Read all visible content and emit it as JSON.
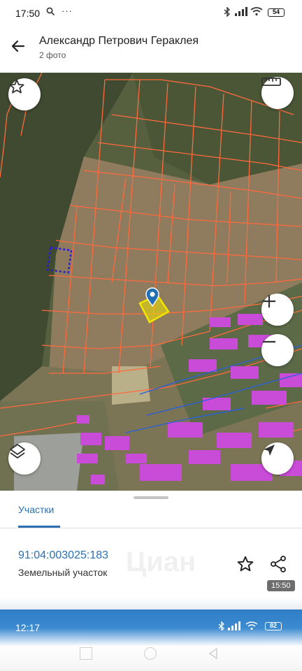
{
  "status_bar": {
    "time": "17:50",
    "icons": [
      "search-icon",
      "more-icon",
      "bluetooth-icon",
      "signal-icon",
      "wifi-icon"
    ],
    "battery": "54"
  },
  "header": {
    "title": "Александр Петрович Гераклея",
    "subtitle": "2 фото"
  },
  "map": {
    "controls": [
      "favorite-star",
      "ruler",
      "zoom-in",
      "zoom-out",
      "layers",
      "my-location"
    ],
    "colors": {
      "parcel_outline": "#ff6a3d",
      "selected_parcel": "#f2e600",
      "marker": "#1f6fb2",
      "building": "#c94cd8",
      "dotted_outline": "#2a1bd6"
    }
  },
  "tabs": {
    "active_label": "Участки"
  },
  "parcel": {
    "cadastral_number": "91:04:003025:183",
    "type": "Земельный участок",
    "watermark": "Циан",
    "video_time": "15:50"
  },
  "second_screen": {
    "time": "12:17",
    "battery": "82"
  }
}
